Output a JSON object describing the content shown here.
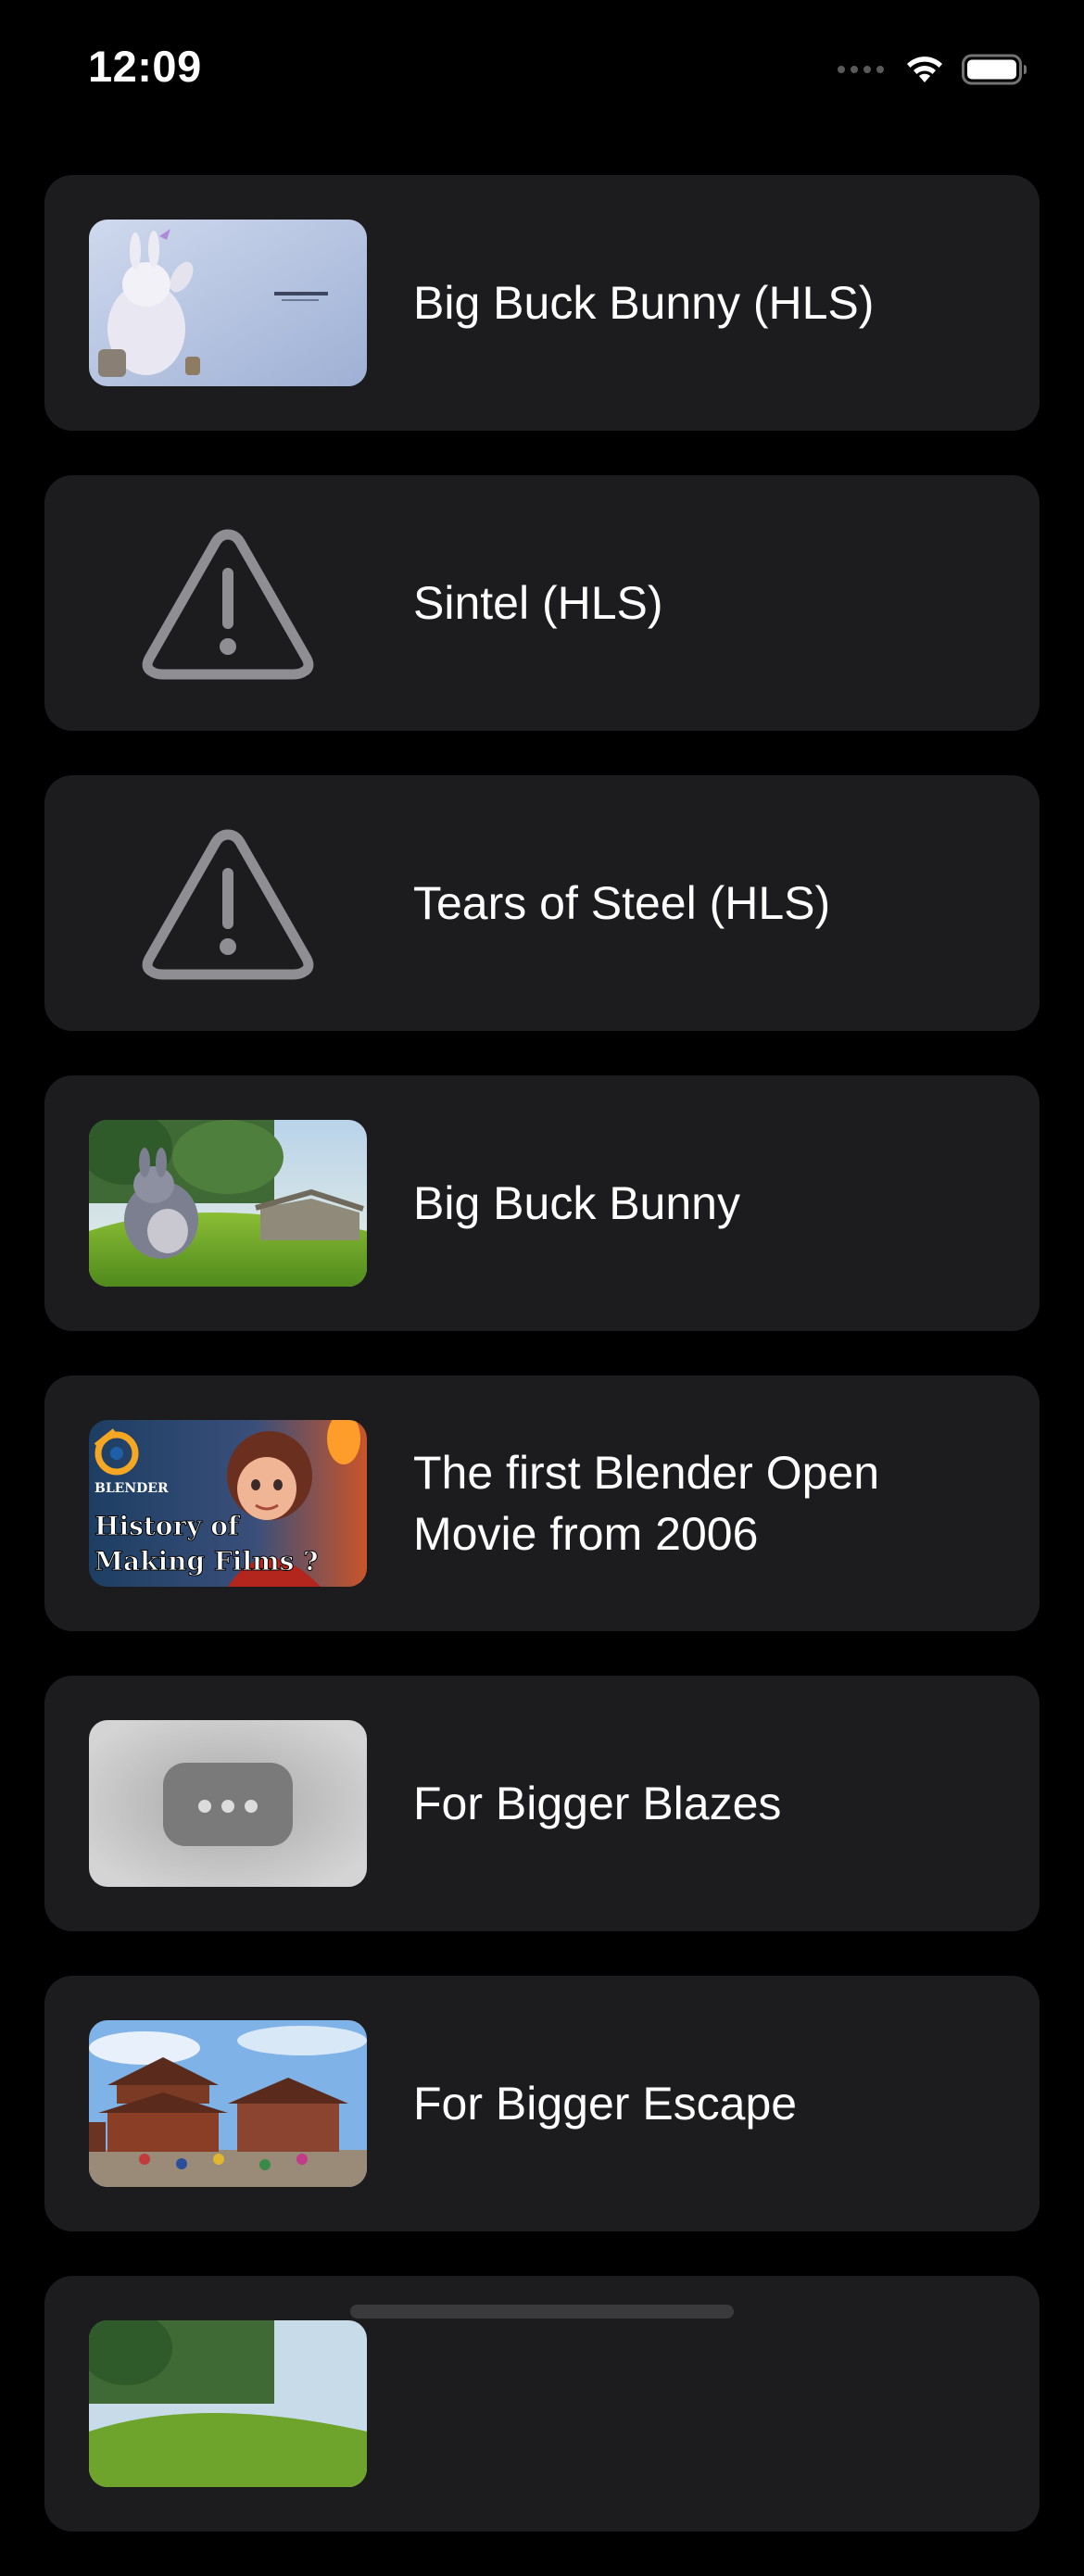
{
  "status_bar": {
    "time": "12:09",
    "icons": [
      "signal-dots-icon",
      "wifi-icon",
      "battery-icon"
    ]
  },
  "videos": [
    {
      "title": "Big Buck Bunny (HLS)",
      "thumbnail": "big-buck-bunny-title-thumbnail"
    },
    {
      "title": "Sintel (HLS)",
      "thumbnail": "warning-icon"
    },
    {
      "title": "Tears of Steel (HLS)",
      "thumbnail": "warning-icon"
    },
    {
      "title": "Big Buck Bunny",
      "thumbnail": "big-buck-bunny-meadow-thumbnail"
    },
    {
      "title": "The first Blender Open Movie from 2006",
      "thumbnail": "blender-history-thumbnail",
      "thumbnail_text": [
        "BLENDER",
        "History of",
        "Making Films ?"
      ]
    },
    {
      "title": "For Bigger Blazes",
      "thumbnail": "placeholder-player-thumbnail"
    },
    {
      "title": "For Bigger Escape",
      "thumbnail": "temple-thumbnail"
    },
    {
      "title": "",
      "thumbnail": "partial-thumbnail"
    }
  ],
  "colors": {
    "background": "#000000",
    "card": "#1c1c1e",
    "text": "#ffffff",
    "warning_icon": "#8e8e93"
  }
}
